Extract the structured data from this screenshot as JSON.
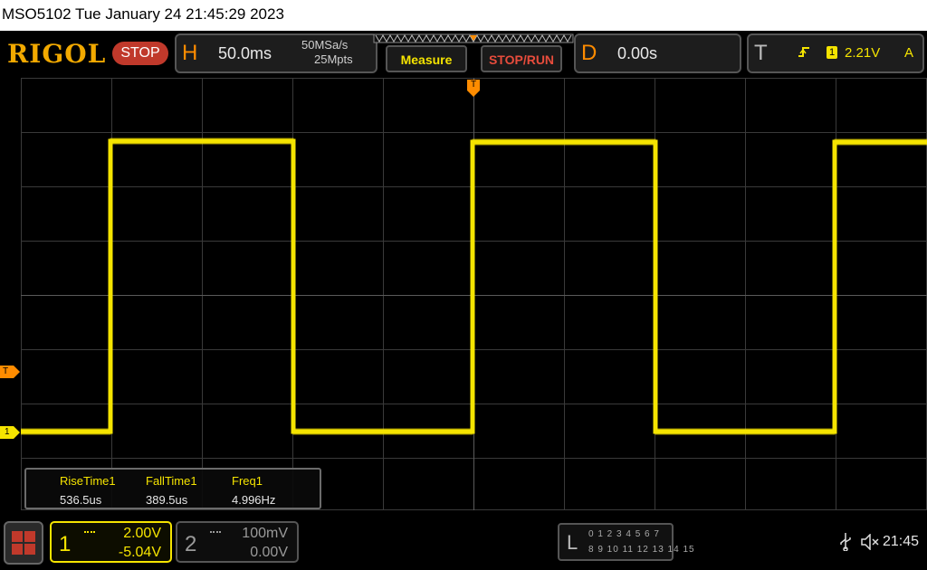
{
  "device": {
    "title": "MSO5102  Tue January 24 21:45:29 2023"
  },
  "toolbar": {
    "logo": "RIGOL",
    "run_state": "STOP",
    "horizontal": {
      "letter": "H",
      "timebase": "50.0ms",
      "sample_rate": "50MSa/s",
      "memory_depth": "25Mpts"
    },
    "measure_label": "Measure",
    "stop_run_label": "STOP/RUN",
    "delay": {
      "letter": "D",
      "value": "0.00s"
    },
    "trigger": {
      "letter": "T",
      "source": "1",
      "level": "2.21V",
      "mode": "A"
    }
  },
  "markers": {
    "trigger_top": "T",
    "trigger_level": "T",
    "ch1_ground": "1"
  },
  "measurements": [
    {
      "name": "RiseTime1",
      "value": "536.5us"
    },
    {
      "name": "FallTime1",
      "value": "389.5us"
    },
    {
      "name": "Freq1",
      "value": "4.996Hz"
    }
  ],
  "channels": [
    {
      "number": "1",
      "scale": "2.00V",
      "offset": "-5.04V",
      "color": "#f5e400"
    },
    {
      "number": "2",
      "scale": "100mV",
      "offset": "0.00V",
      "color": "#9a9a9a"
    }
  ],
  "logic": {
    "letter": "L",
    "row1": "0 1 2 3  4 5 6 7",
    "row2": "8 9 10 11 12 13 14 15"
  },
  "status": {
    "time": "21:45"
  },
  "colors": {
    "accent": "#ff8c00",
    "ch1": "#f5e400",
    "stop": "#c0392b",
    "grid": "#3a3a3a"
  },
  "icons": [
    "menu-icon",
    "usb-icon",
    "speaker-muted-icon",
    "trigger-edge-icon"
  ]
}
